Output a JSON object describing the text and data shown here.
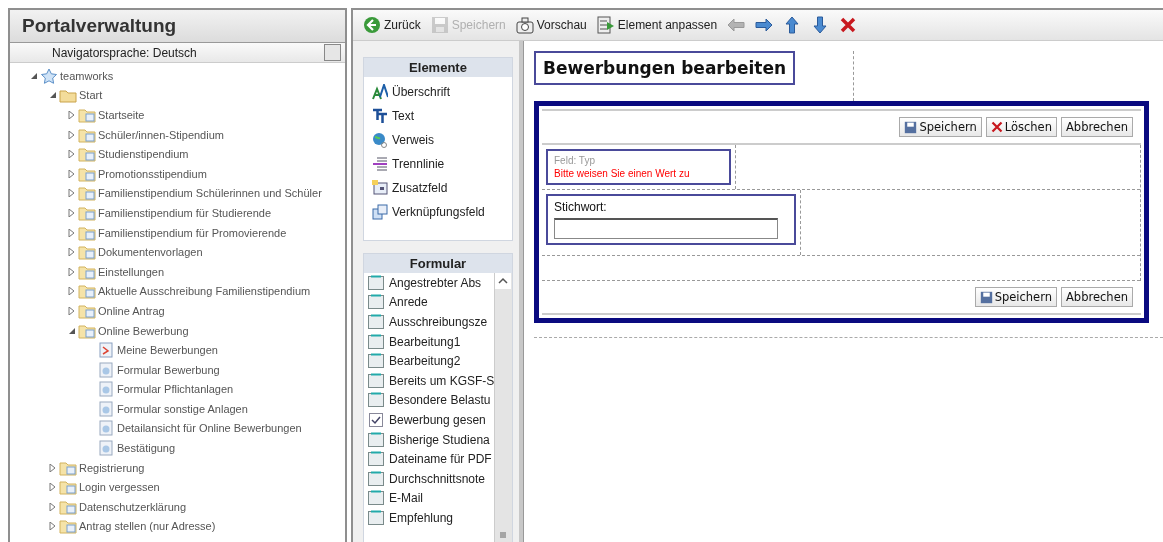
{
  "navigator": {
    "title": "Portalverwaltung",
    "language_label": "Navigatorsprache: Deutsch",
    "language_checked": false,
    "tree": [
      {
        "label": "teamworks",
        "kind": "root",
        "expanded": true,
        "children": [
          {
            "label": "Start",
            "kind": "folder",
            "expanded": true,
            "children": [
              {
                "label": "Startseite",
                "kind": "page",
                "expanded": false
              },
              {
                "label": "Schüler/innen-Stipendium",
                "kind": "page",
                "expanded": false
              },
              {
                "label": "Studienstipendium",
                "kind": "page",
                "expanded": false
              },
              {
                "label": "Promotionsstipendium",
                "kind": "page",
                "expanded": false
              },
              {
                "label": "Familienstipendium Schülerinnen und Schüler",
                "kind": "page",
                "expanded": false
              },
              {
                "label": "Familienstipendium für Studierende",
                "kind": "page",
                "expanded": false
              },
              {
                "label": "Familienstipendium für Promovierende",
                "kind": "page",
                "expanded": false
              },
              {
                "label": "Dokumentenvorlagen",
                "kind": "page",
                "expanded": false
              },
              {
                "label": "Einstellungen",
                "kind": "page",
                "expanded": false
              },
              {
                "label": "Aktuelle Ausschreibung Familienstipendium",
                "kind": "page",
                "expanded": false
              },
              {
                "label": "Online Antrag",
                "kind": "page",
                "expanded": false
              },
              {
                "label": "Online Bewerbung",
                "kind": "page",
                "expanded": true,
                "children": [
                  {
                    "label": "Meine Bewerbungen",
                    "kind": "list"
                  },
                  {
                    "label": "Formular Bewerbung",
                    "kind": "form"
                  },
                  {
                    "label": "Formular Pflichtanlagen",
                    "kind": "form"
                  },
                  {
                    "label": "Formular sonstige Anlagen",
                    "kind": "form"
                  },
                  {
                    "label": "Detailansicht für Online Bewerbungen",
                    "kind": "form"
                  },
                  {
                    "label": "Bestätigung",
                    "kind": "form"
                  }
                ]
              }
            ]
          },
          {
            "label": "Registrierung",
            "kind": "page",
            "expanded": false
          },
          {
            "label": "Login vergessen",
            "kind": "page",
            "expanded": false
          },
          {
            "label": "Datenschutzerklärung",
            "kind": "page",
            "expanded": false
          },
          {
            "label": "Antrag stellen (nur Adresse)",
            "kind": "page",
            "expanded": false
          }
        ]
      }
    ]
  },
  "toolbar": [
    {
      "kind": "back",
      "label": "Zurück",
      "disabled": false
    },
    {
      "kind": "save",
      "label": "Speichern",
      "disabled": true
    },
    {
      "kind": "preview",
      "label": "Vorschau",
      "disabled": false
    },
    {
      "kind": "customize",
      "label": "Element anpassen",
      "disabled": false
    },
    {
      "kind": "left",
      "disabled": true
    },
    {
      "kind": "right",
      "disabled": false
    },
    {
      "kind": "up",
      "disabled": false
    },
    {
      "kind": "down",
      "disabled": false
    },
    {
      "kind": "delete",
      "disabled": false
    }
  ],
  "elements": {
    "title": "Elemente",
    "items": [
      {
        "kind": "heading",
        "label": "Überschrift"
      },
      {
        "kind": "text",
        "label": "Text"
      },
      {
        "kind": "link",
        "label": "Verweis"
      },
      {
        "kind": "divider",
        "label": "Trennlinie"
      },
      {
        "kind": "field",
        "label": "Zusatzfeld"
      },
      {
        "kind": "linkfield",
        "label": "Verknüpfungsfeld"
      }
    ]
  },
  "formular": {
    "title": "Formular",
    "items": [
      {
        "kind": "text",
        "label": "Angestrebter Abs"
      },
      {
        "kind": "text",
        "label": "Anrede"
      },
      {
        "kind": "text",
        "label": "Ausschreibungsze"
      },
      {
        "kind": "text",
        "label": "Bearbeitung1"
      },
      {
        "kind": "text",
        "label": "Bearbeitung2"
      },
      {
        "kind": "text",
        "label": "Bereits um KGSF-S"
      },
      {
        "kind": "text",
        "label": "Besondere Belastu"
      },
      {
        "kind": "checkbox",
        "label": "Bewerbung gesen"
      },
      {
        "kind": "text",
        "label": "Bisherige Studiena"
      },
      {
        "kind": "text",
        "label": "Dateiname für PDF"
      },
      {
        "kind": "text",
        "label": "Durchschnittsnote"
      },
      {
        "kind": "text",
        "label": "E-Mail"
      },
      {
        "kind": "text",
        "label": "Empfehlung"
      }
    ]
  },
  "canvas": {
    "heading": "Bewerbungen bearbeiten",
    "top_buttons": [
      {
        "kind": "save",
        "label": "Speichern"
      },
      {
        "kind": "delete",
        "label": "Löschen"
      },
      {
        "kind": "plain",
        "label": "Abbrechen"
      }
    ],
    "field_caption": "Feld: Typ",
    "field_error": "Bitte weisen Sie einen Wert zu",
    "keyword_label": "Stichwort:",
    "bottom_buttons": [
      {
        "kind": "save",
        "label": "Speichern"
      },
      {
        "kind": "plain",
        "label": "Abbrechen"
      }
    ]
  }
}
